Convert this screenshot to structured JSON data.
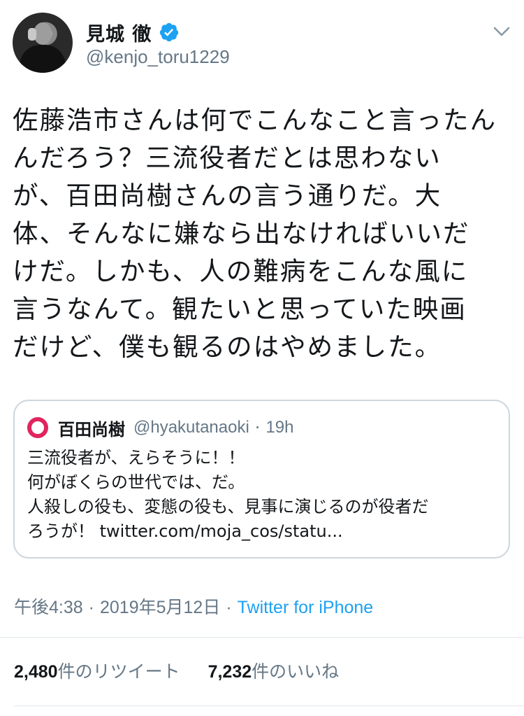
{
  "author": {
    "display_name": "見城 徹",
    "handle": "@kenjo_toru1229",
    "avatar_icon": "profile-photo",
    "verified_icon": "verified-badge-icon",
    "menu_icon": "chevron-down-icon"
  },
  "tweet": {
    "lines": [
      "佐藤浩市さんは何でこんなこと言ったん",
      "んだろう？三流役者だとは思わない",
      "が、百田尚樹さんの言う通りだ。大",
      "体、そんなに嫌なら出なければいいだ",
      "けだ。しかも、人の難病をこんな風に",
      "言うなんて。観たいと思っていた映画",
      "だけど、僕も観るのはやめました。"
    ]
  },
  "quote": {
    "name": "百田尚樹",
    "handle": "@hyakutanaoki",
    "dot": "·",
    "time": "19h",
    "lines": [
      "三流役者が、えらそうに！！",
      "何がぼくらの世代では、だ。",
      "人殺しの役も、変態の役も、見事に演じるのが役者だ",
      "ろうが！ twitter.com/moja_cos/statu..."
    ]
  },
  "meta": {
    "time": "午後4:38",
    "sep1": "·",
    "date": "2019年5月12日",
    "sep2": "·",
    "source": "Twitter for iPhone"
  },
  "stats": {
    "retweets_count": "2,480",
    "retweets_label": "件のリツイート",
    "likes_count": "7,232",
    "likes_label": "件のいいね"
  },
  "colors": {
    "link": "#1da1f2",
    "secondary_text": "#657786",
    "quote_avatar_ring": "#e0245e",
    "border": "#ccd6dd"
  }
}
